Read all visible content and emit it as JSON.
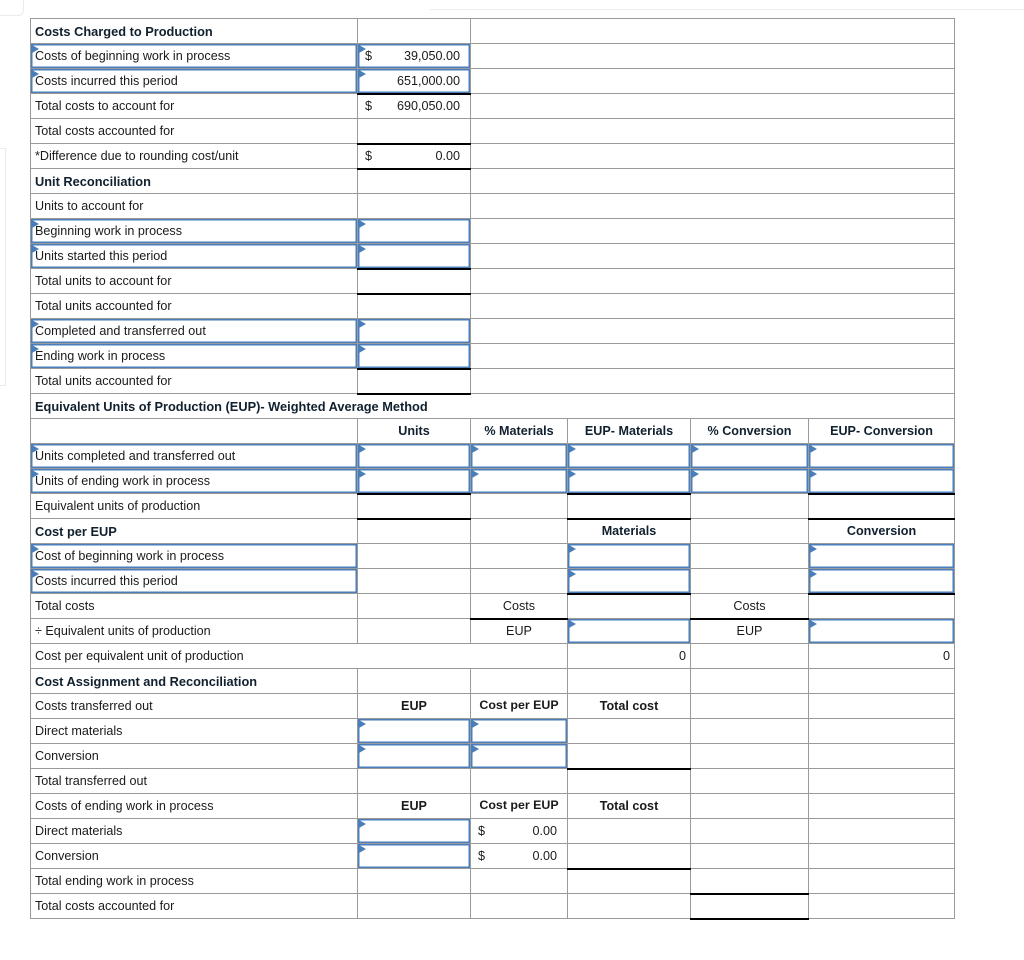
{
  "document": {
    "type": "spreadsheet",
    "title": "Process Costing Production Cost Report - Weighted Average Method"
  },
  "colors": {
    "header_blue": "#6fa8dc",
    "highlight_yellow": "#ffffb3",
    "input_border_blue": "#4a7ebb",
    "grid_line": "#9a9a9a"
  },
  "section_costs_charged": {
    "title": "Costs Charged to Production",
    "rows": [
      {
        "label": "Costs of beginning work in process",
        "currency": "$",
        "value": "39,050.00"
      },
      {
        "label": "Costs incurred this period",
        "currency": "",
        "value": "651,000.00"
      },
      {
        "label": "Total costs to account for",
        "currency": "$",
        "value": "690,050.00"
      },
      {
        "label": "Total costs accounted for",
        "currency": "",
        "value": ""
      },
      {
        "label": "*Difference due to rounding cost/unit",
        "currency": "$",
        "value": "0.00"
      }
    ]
  },
  "section_unit_reconciliation": {
    "title": "Unit Reconciliation",
    "rows": [
      {
        "label": "Units to account for",
        "value": ""
      },
      {
        "label": "Beginning work in process",
        "value": ""
      },
      {
        "label": "Units started this period",
        "value": ""
      },
      {
        "label": "Total units to account for",
        "value": ""
      },
      {
        "label": "Total units accounted for",
        "value": ""
      },
      {
        "label": "Completed and transferred out",
        "value": ""
      },
      {
        "label": "Ending work in process",
        "value": ""
      },
      {
        "label": "Total units accounted for",
        "value": ""
      }
    ]
  },
  "section_eup": {
    "title": "Equivalent Units of Production (EUP)- Weighted Average Method",
    "columns": [
      "",
      "Units",
      "% Materials",
      "EUP- Materials",
      "% Conversion",
      "EUP- Conversion"
    ],
    "rows": [
      {
        "label": "Units completed and transferred out",
        "units": "",
        "pct_materials": "",
        "eup_materials": "",
        "pct_conversion": "",
        "eup_conversion": ""
      },
      {
        "label": "Units of ending work in process",
        "units": "",
        "pct_materials": "",
        "eup_materials": "",
        "pct_conversion": "",
        "eup_conversion": ""
      },
      {
        "label": "Equivalent units of production",
        "units": "",
        "pct_materials": "",
        "eup_materials": "",
        "pct_conversion": "",
        "eup_conversion": ""
      }
    ]
  },
  "section_cost_per_eup": {
    "title": "Cost per EUP",
    "materials_header": "Materials",
    "conversion_header": "Conversion",
    "rows": [
      {
        "label": "Cost of beginning work in process",
        "c2": "",
        "materials": "",
        "c4": "",
        "conversion": ""
      },
      {
        "label": "Costs incurred this period",
        "c2": "",
        "materials": "",
        "c4": "",
        "conversion": ""
      },
      {
        "label": "Total costs",
        "c2": "Costs",
        "materials": "",
        "c4": "Costs",
        "conversion": ""
      },
      {
        "label": "÷ Equivalent units of production",
        "c2": "EUP",
        "materials": "",
        "c4": "EUP",
        "conversion": ""
      }
    ],
    "cost_per_unit_row": {
      "label": "Cost per equivalent unit of production",
      "materials_value": "0",
      "conversion_value": "0"
    }
  },
  "section_cost_assignment": {
    "title": "Cost Assignment and Reconciliation",
    "transferred_out": {
      "label": "Costs transferred out",
      "col_eup": "EUP",
      "col_cost_per_eup": "Cost per EUP",
      "col_total_cost": "Total cost",
      "rows": [
        {
          "label": "Direct materials",
          "eup": "",
          "cost_currency": "",
          "cost_per_eup": "",
          "total_cost": ""
        },
        {
          "label": "Conversion",
          "eup": "",
          "cost_currency": "",
          "cost_per_eup": "",
          "total_cost": ""
        }
      ],
      "total_label": "Total transferred out",
      "total_value": ""
    },
    "ending_wip": {
      "label": "Costs of ending work in process",
      "col_eup": "EUP",
      "col_cost_per_eup": "Cost per EUP",
      "col_total_cost": "Total cost",
      "rows": [
        {
          "label": "Direct materials",
          "eup": "",
          "cost_currency": "$",
          "cost_per_eup": "0.00",
          "total_cost": ""
        },
        {
          "label": "Conversion",
          "eup": "",
          "cost_currency": "$",
          "cost_per_eup": "0.00",
          "total_cost": ""
        }
      ],
      "total_label": "Total ending work in process",
      "total_value": ""
    },
    "grand_total": {
      "label": "Total costs accounted for",
      "value": ""
    }
  }
}
